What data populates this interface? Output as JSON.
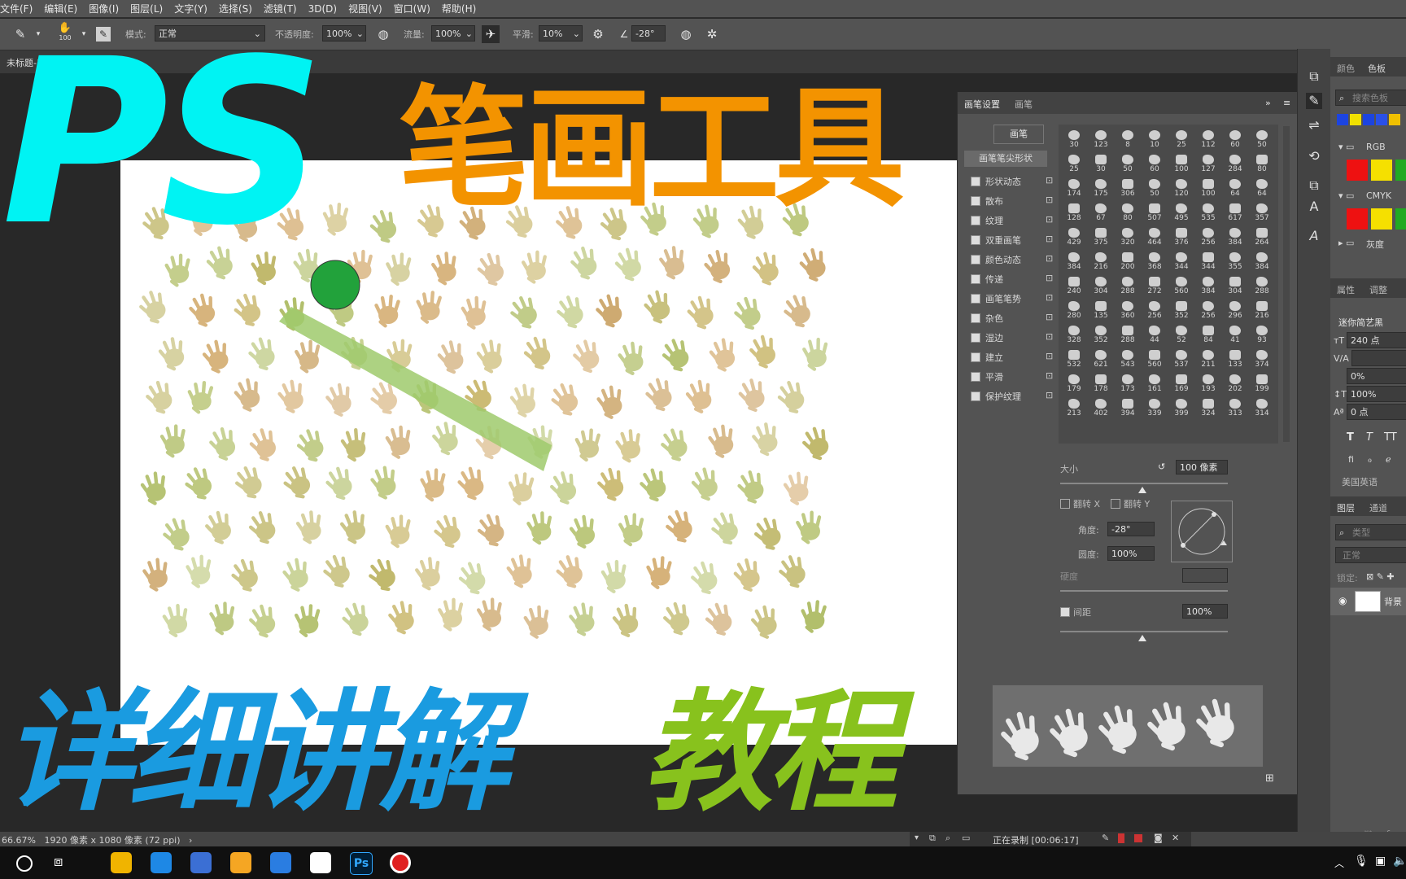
{
  "menu": [
    "文件(F)",
    "编辑(E)",
    "图像(I)",
    "图层(L)",
    "文字(Y)",
    "选择(S)",
    "滤镜(T)",
    "3D(D)",
    "视图(V)",
    "窗口(W)",
    "帮助(H)"
  ],
  "options": {
    "brush_size": "100",
    "mode_label": "模式:",
    "mode_value": "正常",
    "opacity_label": "不透明度:",
    "opacity_value": "100%",
    "flow_label": "流量:",
    "flow_value": "100%",
    "smoothing_label": "平滑:",
    "smoothing_value": "10%",
    "angle_value": "-28°"
  },
  "document": {
    "tab_label": "未标题-1"
  },
  "overlay": {
    "title_ps": "PS",
    "title_tool": "笔画工具",
    "subtitle_detail": "详细讲解",
    "subtitle_course": "教程",
    "colors": {
      "ps": "#00f3f3",
      "tool": "#f39300",
      "detail": "#1a9be0",
      "course": "#88c21d"
    }
  },
  "brush_panel": {
    "tabs": [
      "画笔设置",
      "画笔"
    ],
    "preset_button": "画笔",
    "tip_shape": "画笔笔尖形状",
    "options": [
      {
        "label": "形状动态",
        "checked": true
      },
      {
        "label": "散布",
        "checked": true
      },
      {
        "label": "纹理",
        "checked": true
      },
      {
        "label": "双重画笔",
        "checked": true
      },
      {
        "label": "颜色动态",
        "checked": true
      },
      {
        "label": "传递",
        "checked": true
      },
      {
        "label": "画笔笔势",
        "checked": true
      },
      {
        "label": "杂色",
        "checked": true
      },
      {
        "label": "湿边",
        "checked": true
      },
      {
        "label": "建立",
        "checked": true
      },
      {
        "label": "平滑",
        "checked": true
      },
      {
        "label": "保护纹理",
        "checked": true
      }
    ],
    "tip_sizes": [
      "30",
      "123",
      "8",
      "10",
      "25",
      "112",
      "60",
      "50",
      "25",
      "30",
      "50",
      "60",
      "100",
      "127",
      "284",
      "80",
      "174",
      "175",
      "306",
      "50",
      "120",
      "100",
      "64",
      "64",
      "128",
      "67",
      "80",
      "507",
      "495",
      "535",
      "617",
      "357",
      "429",
      "375",
      "320",
      "464",
      "376",
      "256",
      "384",
      "264",
      "384",
      "216",
      "200",
      "368",
      "344",
      "344",
      "355",
      "384",
      "240",
      "304",
      "288",
      "272",
      "560",
      "384",
      "304",
      "288",
      "280",
      "135",
      "360",
      "256",
      "352",
      "256",
      "296",
      "216",
      "328",
      "352",
      "288",
      "44",
      "52",
      "84",
      "41",
      "93",
      "532",
      "621",
      "543",
      "560",
      "537",
      "211",
      "133",
      "374",
      "179",
      "178",
      "173",
      "161",
      "169",
      "193",
      "202",
      "199",
      "213",
      "402",
      "394",
      "339",
      "399",
      "324",
      "313",
      "314"
    ],
    "size_label": "大小",
    "size_value": "100 像素",
    "flip_x": "翻转 X",
    "flip_y": "翻转 Y",
    "angle_label": "角度:",
    "angle_value": "-28°",
    "roundness_label": "圆度:",
    "roundness_value": "100%",
    "hardness_label": "硬度",
    "spacing_label": "间距",
    "spacing_value": "100%"
  },
  "right_panels": {
    "tabs_top": [
      "颜色",
      "色板"
    ],
    "search_swatches": "搜索色板",
    "groups": [
      "RGB",
      "CMYK",
      "灰度"
    ],
    "tabs_props": [
      "属性",
      "调整"
    ],
    "font_name": "迷你简艺黑",
    "font_size": "240 点",
    "tracking": "0%",
    "scale": "100%",
    "baseline": "0 点",
    "language": "美国英语",
    "tabs_layers": [
      "图层",
      "通道"
    ],
    "layer_search": "类型",
    "blend": "正常",
    "lock_label": "锁定:",
    "layer_name": "背景"
  },
  "status": {
    "zoom": "66.67%",
    "doc_size": "1920 像素 x 1080 像素 (72 ppi)",
    "recording": "正在录制 [00:06:17]"
  },
  "taskbar": {
    "apps": [
      {
        "name": "file-explorer",
        "color": "#f0b400"
      },
      {
        "name": "sogou",
        "color": "#1e88e5"
      },
      {
        "name": "app-person",
        "color": "#3b6fd4"
      },
      {
        "name": "security",
        "color": "#f5a623"
      },
      {
        "name": "kugou",
        "color": "#2a7de1"
      },
      {
        "name": "app-flower",
        "color": "#ffffff"
      },
      {
        "name": "photoshop",
        "color": "#001e36"
      },
      {
        "name": "recorder",
        "color": "#e02020"
      }
    ],
    "ps_label": "Ps"
  }
}
